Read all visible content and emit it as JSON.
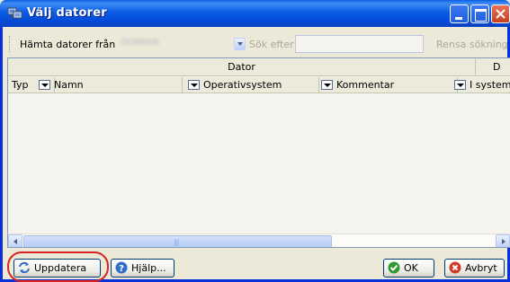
{
  "window": {
    "title": "Välj datorer"
  },
  "toolbar": {
    "fetch_from_label": "Hämta datorer från",
    "server_value": "DOMAIN",
    "search_label": "Sök efter",
    "search_value": "",
    "clear_search_label": "Rensa sökning"
  },
  "grid": {
    "group_headers": [
      "Dator",
      "D"
    ],
    "columns": [
      "Typ",
      "Namn",
      "Operativsystem",
      "Kommentar",
      "I system"
    ],
    "rows": []
  },
  "buttons": {
    "refresh": "Uppdatera",
    "help": "Hjälp...",
    "ok": "OK",
    "cancel": "Avbryt"
  },
  "colors": {
    "titlebar": "#0a5ee8",
    "highlight_ring": "#dd2222"
  }
}
